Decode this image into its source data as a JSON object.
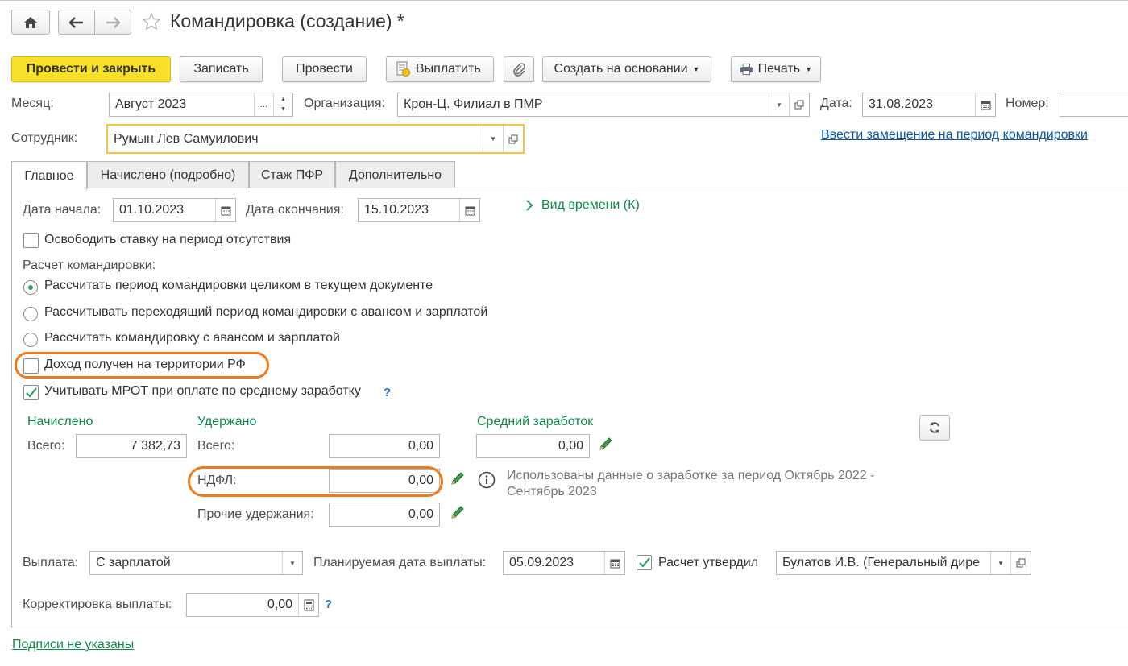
{
  "window": {
    "title": "Командировка (создание) *"
  },
  "toolbar": {
    "post_close": "Провести и закрыть",
    "save": "Записать",
    "post": "Провести",
    "pay": "Выплатить",
    "create_based": "Создать на основании",
    "print": "Печать"
  },
  "header": {
    "month_label": "Месяц:",
    "month_value": "Август 2023",
    "month_ellipsis": "...",
    "org_label": "Организация:",
    "org_value": "Крон-Ц. Филиал в ПМР",
    "date_label": "Дата:",
    "date_value": "31.08.2023",
    "number_label": "Номер:",
    "number_value": "",
    "employee_label": "Сотрудник:",
    "employee_value": "Румын Лев Самуилович",
    "replacement_link": "Ввести замещение на период командировки"
  },
  "tabs": [
    {
      "label": "Главное"
    },
    {
      "label": "Начислено (подробно)"
    },
    {
      "label": "Стаж ПФР"
    },
    {
      "label": "Дополнительно"
    }
  ],
  "main": {
    "start_label": "Дата начала:",
    "start_value": "01.10.2023",
    "end_label": "Дата окончания:",
    "end_value": "15.10.2023",
    "time_kind": "Вид времени (К)",
    "free_rate": "Освободить ставку на период отсутствия",
    "calc_label": "Расчет командировки:",
    "radio_1": "Рассчитать период командировки целиком в текущем документе",
    "radio_2": "Рассчитывать переходящий период командировки с авансом и зарплатой",
    "radio_3": "Рассчитать командировку с авансом и зарплатой",
    "income_rf": "Доход получен на территории РФ",
    "mrot": "Учитывать МРОТ при оплате по среднему заработку",
    "help": "?"
  },
  "totals": {
    "accrued_head": "Начислено",
    "withheld_head": "Удержано",
    "avg_head": "Средний заработок",
    "accrued_total_label": "Всего:",
    "accrued_total": "7 382,73",
    "withheld_total_label": "Всего:",
    "withheld_total": "0,00",
    "ndfl_label": "НДФЛ:",
    "ndfl_value": "0,00",
    "other_label": "Прочие удержания:",
    "other_value": "0,00",
    "avg_value": "0,00",
    "info_text_1": "Использованы данные о заработке за период Октябрь 2022 -",
    "info_text_2": "Сентябрь 2023"
  },
  "payment": {
    "pay_label": "Выплата:",
    "pay_value": "С зарплатой",
    "planned_label": "Планируемая дата выплаты:",
    "planned_value": "05.09.2023",
    "approved_label": "Расчет утвердил",
    "approver_value": "Булатов И.В. (Генеральный дире",
    "correction_label": "Корректировка выплаты:",
    "correction_value": "0,00"
  },
  "footer": {
    "signatures_link": "Подписи не указаны"
  },
  "colors": {
    "accent_yellow": "#f8df2a",
    "highlight_orange": "#ef7a1c",
    "green_text": "#0f8a4c",
    "link_blue": "#0b56a5"
  }
}
